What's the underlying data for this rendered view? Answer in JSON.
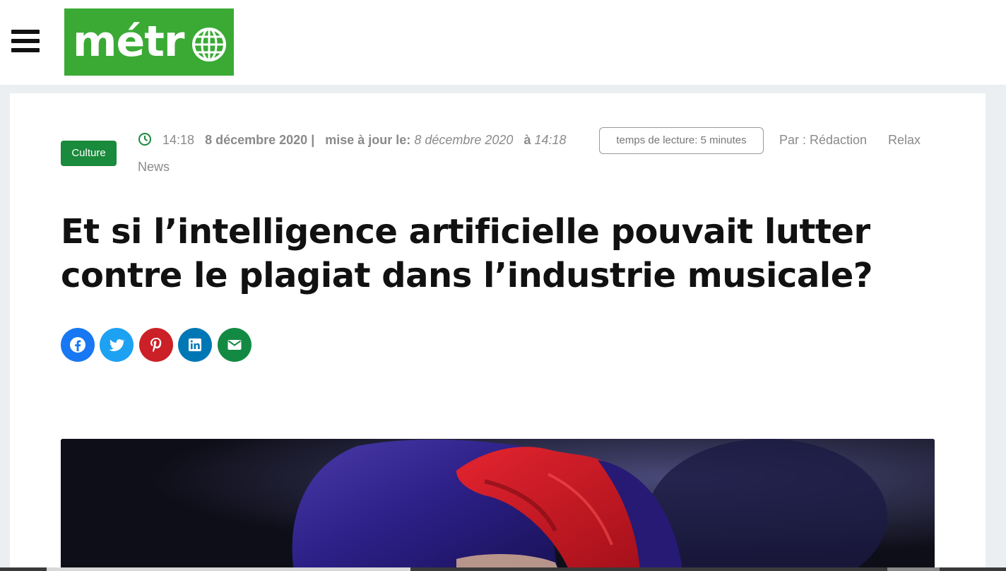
{
  "header": {
    "menu_icon": "hamburger-menu-icon",
    "logo_text": "métr",
    "logo_icon": "globe-icon",
    "logo_color": "#3aaa35"
  },
  "article": {
    "category": "Culture",
    "time": "14:18",
    "date": "8 décembre 2020",
    "separator": "|",
    "updated_label": "mise à jour le:",
    "updated_date": "8 décembre 2020",
    "updated_at_word": "à",
    "updated_time": "14:18",
    "reading_time": "temps de lecture: 5 minutes",
    "author": "Par : Rédaction",
    "source_1": "Relax",
    "source_2": "News",
    "title": "Et si l’intelligence artificielle pouvait lutter contre le plagiat dans l’industrie musicale?"
  },
  "share": [
    {
      "name": "facebook",
      "icon": "facebook-icon",
      "color": "#1877f2"
    },
    {
      "name": "twitter",
      "icon": "twitter-icon",
      "color": "#1da1f2"
    },
    {
      "name": "pinterest",
      "icon": "pinterest-icon",
      "color": "#cb2027"
    },
    {
      "name": "linkedin",
      "icon": "linkedin-icon",
      "color": "#0077b5"
    },
    {
      "name": "email",
      "icon": "email-icon",
      "color": "#138a44"
    }
  ],
  "colors": {
    "badge": "#1a8a3c",
    "meta_text": "#8a8a8a",
    "headline": "#111111"
  }
}
